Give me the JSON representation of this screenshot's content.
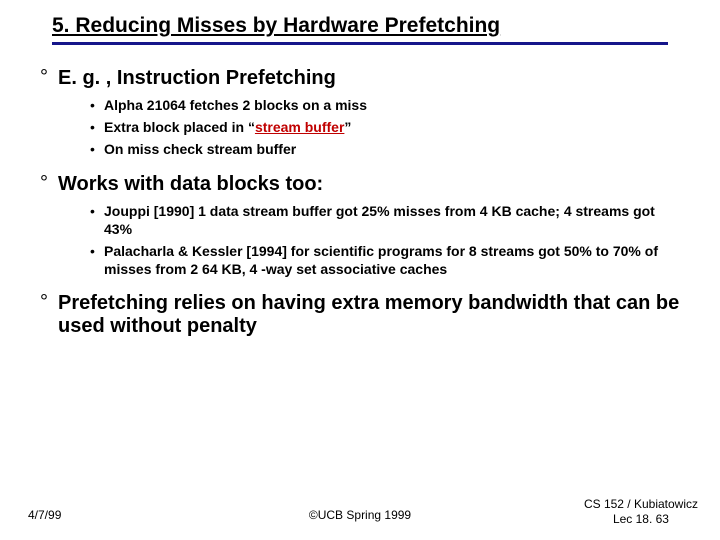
{
  "title": "5. Reducing Misses by Hardware Prefetching",
  "points": [
    {
      "text": "E. g. , Instruction Prefetching",
      "subs": [
        {
          "pre": "Alpha 21064 fetches 2 blocks on a miss"
        },
        {
          "pre": "Extra block placed in “",
          "hl": "stream buffer",
          "post": "”"
        },
        {
          "pre": "On miss check stream buffer"
        }
      ]
    },
    {
      "text": "Works with data blocks too:",
      "subs": [
        {
          "pre": "Jouppi [1990] 1 data stream buffer got 25% misses from 4 KB cache; 4 streams got 43%"
        },
        {
          "pre": "Palacharla & Kessler [1994] for scientific programs for 8 streams got 50% to 70% of misses from 2 64 KB, 4 -way set associative caches"
        }
      ]
    },
    {
      "text": "Prefetching relies on having extra memory bandwidth that can be used without penalty",
      "subs": []
    }
  ],
  "footer": {
    "date": "4/7/99",
    "center": "©UCB Spring 1999",
    "right1": "CS 152 / Kubiatowicz",
    "right2": "Lec 18. 63"
  }
}
